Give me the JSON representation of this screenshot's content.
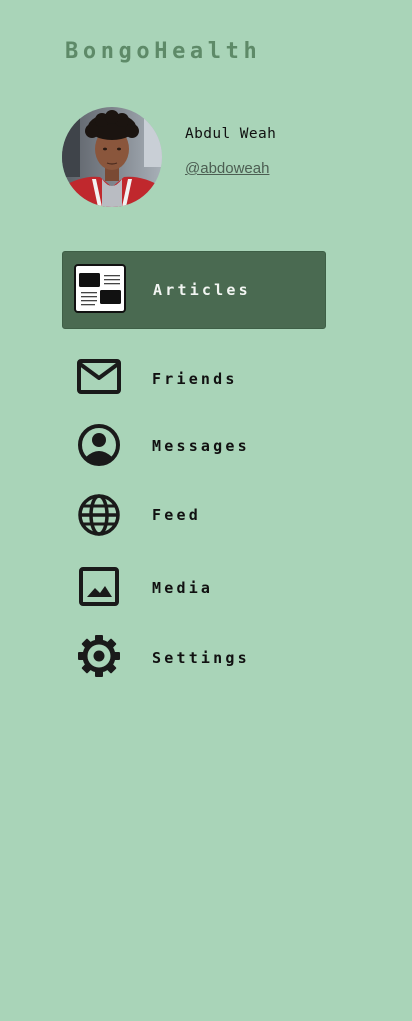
{
  "app": {
    "brand": "BongoHealth"
  },
  "profile": {
    "name": "Abdul Weah",
    "handle": "@abdoweah",
    "avatar_icon": "user-photo"
  },
  "nav": {
    "items": [
      {
        "label": "Articles",
        "icon": "newspaper-icon",
        "active": true
      },
      {
        "label": "Friends",
        "icon": "envelope-icon",
        "active": false
      },
      {
        "label": "Messages",
        "icon": "user-circle-icon",
        "active": false
      },
      {
        "label": "Feed",
        "icon": "globe-icon",
        "active": false
      },
      {
        "label": "Media",
        "icon": "image-icon",
        "active": false
      },
      {
        "label": "Settings",
        "icon": "gear-icon",
        "active": false
      }
    ]
  },
  "colors": {
    "background": "#a9d4b8",
    "brand_text": "#5e8a68",
    "active_item": "#4a6a51",
    "icon": "#1a1a1a"
  }
}
